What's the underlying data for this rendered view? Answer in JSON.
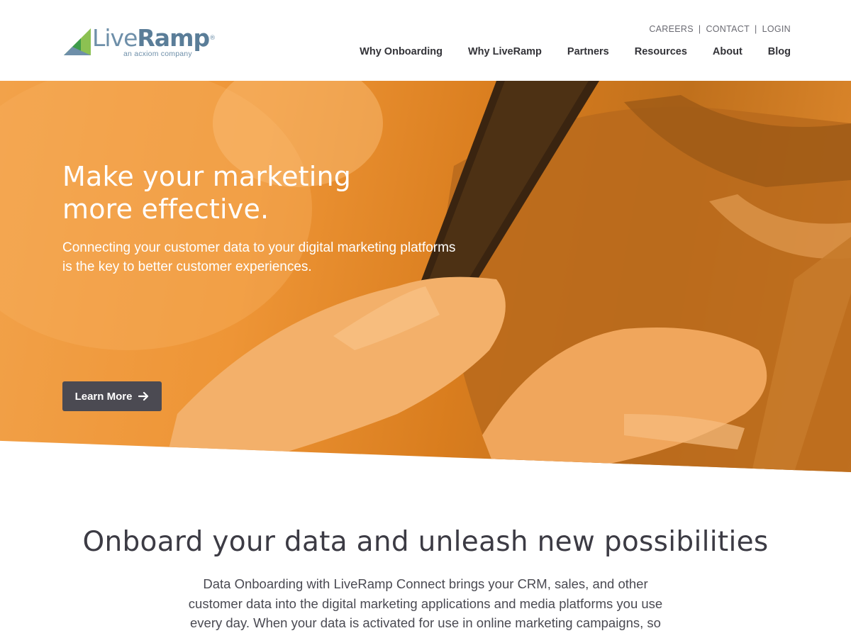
{
  "brand": {
    "name_part1": "Live",
    "name_part2": "Ramp",
    "registered": "®",
    "tagline": "an acxiom company",
    "logo_colors": [
      "#8cc152",
      "#3d9b4a",
      "#6e8fa9"
    ]
  },
  "utility_nav": {
    "items": [
      "CAREERS",
      "CONTACT",
      "LOGIN"
    ],
    "separator": "|"
  },
  "main_nav": {
    "items": [
      "Why Onboarding",
      "Why LiveRamp",
      "Partners",
      "Resources",
      "About",
      "Blog"
    ]
  },
  "hero": {
    "title_line1": "Make your marketing",
    "title_line2": "more effective.",
    "subtitle_line1": "Connecting your customer data to your digital marketing platforms",
    "subtitle_line2": "is the key to better customer experiences.",
    "cta_label": "Learn More",
    "cta_icon": "arrow-right-icon",
    "background_color": "#ee9536"
  },
  "section": {
    "title": "Onboard your data and unleash new possibilities",
    "body_line1": "Data Onboarding with LiveRamp Connect brings your CRM, sales, and other",
    "body_line2": "customer data into the digital marketing applications and media platforms you use",
    "body_line3": "every day. When your data is activated for use in online marketing campaigns, so"
  },
  "colors": {
    "text_dark": "#3c3b44",
    "button_bg": "#4b4a52",
    "hero_orange": "#ee9536"
  }
}
